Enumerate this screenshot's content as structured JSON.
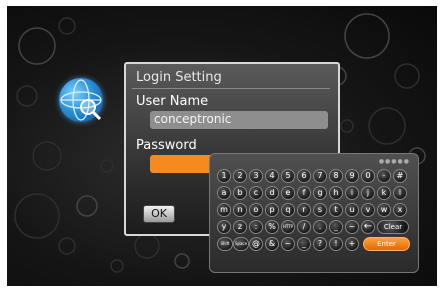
{
  "dialog": {
    "title": "Login Setting",
    "username_label": "User Name",
    "username_value": "conceptronic",
    "password_label": "Password",
    "ok_label": "OK"
  },
  "keyboard": {
    "rows": [
      [
        "1",
        "2",
        "3",
        "4",
        "5",
        "6",
        "7",
        "8",
        "9",
        "0",
        "-",
        "#"
      ],
      [
        "a",
        "b",
        "c",
        "d",
        "e",
        "f",
        "g",
        "h",
        "i",
        "j",
        "k",
        "l"
      ],
      [
        "m",
        "n",
        "o",
        "p",
        "q",
        "r",
        "s",
        "t",
        "u",
        "v",
        "w",
        "x"
      ],
      [
        "y",
        "z",
        ":",
        "%",
        "HTTP",
        "/",
        ".",
        "_",
        "~",
        "←"
      ]
    ],
    "bottom_row": [
      "Shift",
      "Space",
      "@",
      "&",
      "~",
      "_",
      "?",
      "!",
      "+"
    ],
    "clear_label": "Clear",
    "enter_label": "Enter"
  },
  "icons": {
    "network": "globe-search-icon",
    "backspace": "backspace-arrow-icon"
  },
  "colors": {
    "accent": "#f58a1e",
    "field": "#8e8e8e"
  }
}
